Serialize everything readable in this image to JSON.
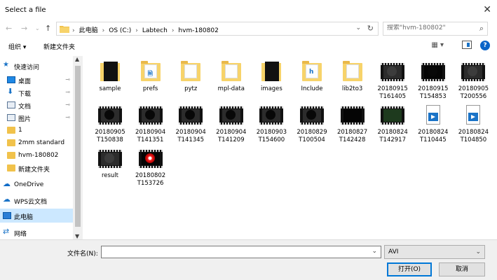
{
  "window": {
    "title": "Select a file",
    "close_glyph": "✕"
  },
  "nav": {
    "back_glyph": "←",
    "forward_glyph": "→",
    "dropdown_glyph": "⌄",
    "up_glyph": "↑"
  },
  "address": {
    "crumbs": [
      "此电脑",
      "OS (C:)",
      "Labtech",
      "hvm-180802"
    ],
    "separator": "›",
    "chevron": "⌄",
    "refresh": "↻"
  },
  "search": {
    "placeholder": "搜索\"hvm-180802\"",
    "icon": "⌕"
  },
  "toolbar": {
    "organize": "组织 ▾",
    "new_folder": "新建文件夹",
    "view_glyph": "▦ ▾",
    "help": "?"
  },
  "sidebar": {
    "items": [
      {
        "label": "快速访问",
        "icon": "star-icon",
        "glyph": "★",
        "pinned": false
      },
      {
        "label": "桌面",
        "icon": "desktop-icon",
        "glyph": "",
        "pinned": true
      },
      {
        "label": "下载",
        "icon": "download-icon",
        "glyph": "⬇",
        "pinned": true
      },
      {
        "label": "文档",
        "icon": "document-icon",
        "glyph": "",
        "pinned": true
      },
      {
        "label": "图片",
        "icon": "pictures-icon",
        "glyph": "",
        "pinned": true
      },
      {
        "label": "1",
        "icon": "folder-icon",
        "glyph": "",
        "pinned": false
      },
      {
        "label": "2mm standard",
        "icon": "folder-icon",
        "glyph": "",
        "pinned": false
      },
      {
        "label": "hvm-180802",
        "icon": "folder-icon",
        "glyph": "",
        "pinned": false
      },
      {
        "label": "新建文件夹",
        "icon": "folder-icon",
        "glyph": "",
        "pinned": false
      },
      {
        "label": "OneDrive",
        "icon": "onedrive-icon",
        "glyph": "☁",
        "pinned": false
      },
      {
        "label": "WPS云文档",
        "icon": "wps-cloud-icon",
        "glyph": "☁",
        "pinned": false
      },
      {
        "label": "此电脑",
        "icon": "this-pc-icon",
        "glyph": "",
        "pinned": false,
        "selected": true
      },
      {
        "label": "网络",
        "icon": "network-icon",
        "glyph": "⇄",
        "pinned": false
      }
    ],
    "pin_glyph": "📌"
  },
  "files": [
    {
      "name": "sample",
      "kind": "black-folder"
    },
    {
      "name": "prefs",
      "kind": "folder",
      "mark": "🗎"
    },
    {
      "name": "pytz",
      "kind": "folder",
      "mark": ""
    },
    {
      "name": "mpl-data",
      "kind": "folder",
      "mark": ""
    },
    {
      "name": "images",
      "kind": "black-folder"
    },
    {
      "name": "Include",
      "kind": "folder",
      "mark": "h"
    },
    {
      "name": "lib2to3",
      "kind": "folder",
      "mark": ""
    },
    {
      "name": "20180915\nT161405",
      "kind": "video",
      "frame": "gray",
      "blob": "gray"
    },
    {
      "name": "20180915\nT154853",
      "kind": "video",
      "frame": "black",
      "blob": "dark"
    },
    {
      "name": "20180905\nT200556",
      "kind": "video",
      "frame": "gray",
      "blob": "gray"
    },
    {
      "name": "20180905\nT150838",
      "kind": "video",
      "frame": "gray",
      "blob": "dark"
    },
    {
      "name": "20180904\nT141351",
      "kind": "video",
      "frame": "gray",
      "blob": "dark"
    },
    {
      "name": "20180904\nT141345",
      "kind": "video",
      "frame": "gray",
      "blob": "dark"
    },
    {
      "name": "20180904\nT141209",
      "kind": "video",
      "frame": "gray",
      "blob": "dark"
    },
    {
      "name": "20180903\nT154600",
      "kind": "video",
      "frame": "gray",
      "blob": "dark"
    },
    {
      "name": "20180829\nT100504",
      "kind": "video",
      "frame": "gray",
      "blob": "dark"
    },
    {
      "name": "20180827\nT142428",
      "kind": "video",
      "frame": "black",
      "blob": "none"
    },
    {
      "name": "20180824\nT142917",
      "kind": "video",
      "frame": "green",
      "blob": "none"
    },
    {
      "name": "20180824\nT110445",
      "kind": "doc"
    },
    {
      "name": "20180824\nT104850",
      "kind": "doc"
    },
    {
      "name": "result",
      "kind": "video",
      "frame": "gray",
      "blob": "gray"
    },
    {
      "name": "20180802\nT153726",
      "kind": "video",
      "frame": "black",
      "blob": "red"
    }
  ],
  "footer": {
    "filename_label": "文件名(N):",
    "filename_value": "",
    "filetype": "AVI",
    "chevron": "⌄",
    "open": "打开(O)",
    "cancel": "取消"
  }
}
